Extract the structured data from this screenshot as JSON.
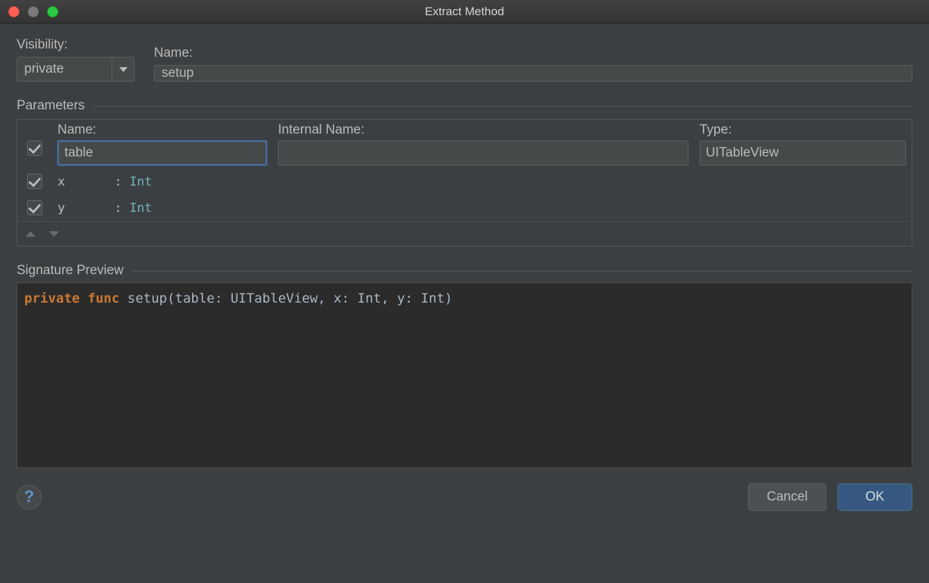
{
  "window": {
    "title": "Extract Method"
  },
  "labels": {
    "visibility": "Visibility:",
    "name": "Name:",
    "parameters": "Parameters",
    "param_name": "Name:",
    "param_internal": "Internal Name:",
    "param_type": "Type:",
    "signature_preview": "Signature Preview"
  },
  "form": {
    "visibility_value": "private",
    "method_name": "setup"
  },
  "parameters": [
    {
      "checked": true,
      "name": "table",
      "internal": "",
      "type": "UITableView",
      "editing": true
    },
    {
      "checked": true,
      "name": "x",
      "internal": "",
      "type": "Int",
      "editing": false
    },
    {
      "checked": true,
      "name": "y",
      "internal": "",
      "type": "Int",
      "editing": false
    }
  ],
  "signature": {
    "kw_private": "private",
    "kw_func": "func",
    "text": "setup(table: UITableView, x: Int, y: Int)"
  },
  "buttons": {
    "cancel": "Cancel",
    "ok": "OK",
    "help": "?"
  }
}
